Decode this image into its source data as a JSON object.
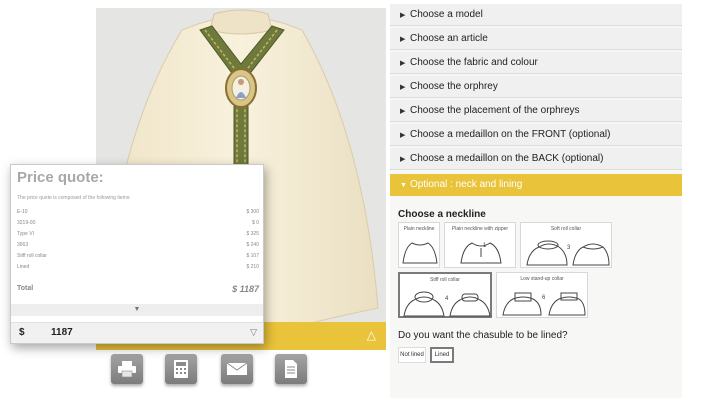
{
  "accordion": [
    {
      "label": "Choose a model"
    },
    {
      "label": "Choose an article"
    },
    {
      "label": "Choose the fabric and colour"
    },
    {
      "label": "Choose the orphrey"
    },
    {
      "label": "Choose the placement of the orphreys"
    },
    {
      "label": "Choose a medaillon on the FRONT (optional)"
    },
    {
      "label": "Choose a medaillon on the BACK (optional)"
    },
    {
      "label": "Optional : neck and lining",
      "active": true
    }
  ],
  "neckline": {
    "heading": "Choose a neckline",
    "options": [
      {
        "label": "Plain neckline",
        "number": "",
        "selected": false
      },
      {
        "label": "Plain neckline with zipper",
        "number": "1",
        "selected": false
      },
      {
        "label": "Soft roll collar",
        "number": "3",
        "selected": false
      },
      {
        "label": "Stiff roll collar",
        "number": "4",
        "selected": true
      },
      {
        "label": "Low stand-up collar",
        "number": "6",
        "selected": false
      }
    ]
  },
  "lining": {
    "question": "Do you want the chasuble to be lined?",
    "options": [
      "Not lined",
      "Lined"
    ],
    "selected": "Lined"
  },
  "quote": {
    "title": "Price quote:",
    "description": "The price quote is composed of the following items:",
    "items": [
      {
        "name": "E-10",
        "price": "$ 300"
      },
      {
        "name": "3219-00",
        "price": "$ 0"
      },
      {
        "name": "Type VI",
        "price": "$ 325"
      },
      {
        "name": "3663",
        "price": "$ 240"
      },
      {
        "name": "Stiff roll collar",
        "price": "$ 107"
      },
      {
        "name": "Lined",
        "price": "$ 210"
      }
    ],
    "total_label": "Total",
    "total_value": "$ 1187",
    "currency": "$",
    "amount": "1187"
  },
  "toolbar": {
    "icons": [
      "print-icon",
      "calculator-icon",
      "mail-icon",
      "document-icon"
    ]
  },
  "colors": {
    "accent": "#e9c33a",
    "chasuble": "#f3ead0",
    "orphrey": "#6d7a3c"
  }
}
